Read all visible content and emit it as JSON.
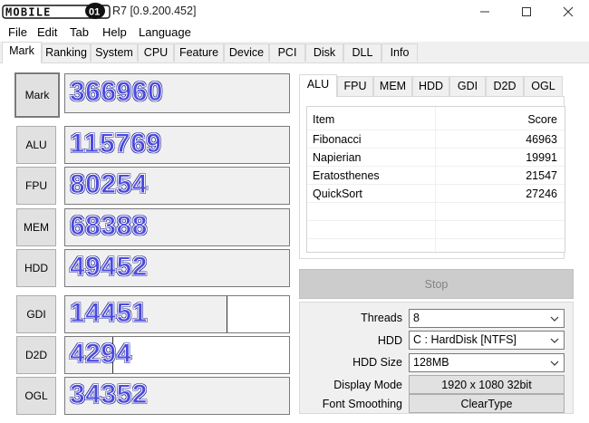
{
  "window": {
    "title": "R7 [0.9.200.452]",
    "logo_text": "MOBILE01"
  },
  "menu": [
    "File",
    "Edit",
    "Tab",
    "Help",
    "Language"
  ],
  "tabs": [
    "Mark",
    "Ranking",
    "System",
    "CPU",
    "Feature",
    "Device",
    "PCI",
    "Disk",
    "DLL",
    "Info"
  ],
  "marks": {
    "total": {
      "label": "Mark",
      "value": "366960",
      "fill": 1.0
    },
    "items": [
      {
        "label": "ALU",
        "value": "115769",
        "fill": 1.0
      },
      {
        "label": "FPU",
        "value": "80254",
        "fill": 1.0
      },
      {
        "label": "MEM",
        "value": "68388",
        "fill": 1.0
      },
      {
        "label": "HDD",
        "value": "49452",
        "fill": 1.0
      },
      {
        "label": "GDI",
        "value": "14451",
        "fill": 0.72
      },
      {
        "label": "D2D",
        "value": "4294",
        "fill": 0.21
      },
      {
        "label": "OGL",
        "value": "34352",
        "fill": 1.0
      }
    ]
  },
  "subtabs": [
    "ALU",
    "FPU",
    "MEM",
    "HDD",
    "GDI",
    "D2D",
    "OGL"
  ],
  "results": {
    "headers": {
      "item": "Item",
      "score": "Score"
    },
    "rows": [
      {
        "item": "Fibonacci",
        "score": "46963"
      },
      {
        "item": "Napierian",
        "score": "19991"
      },
      {
        "item": "Eratosthenes",
        "score": "21547"
      },
      {
        "item": "QuickSort",
        "score": "27246"
      }
    ]
  },
  "stop_label": "Stop",
  "settings": {
    "threads": {
      "label": "Threads",
      "value": "8"
    },
    "hdd": {
      "label": "HDD",
      "value": "C : HardDisk [NTFS]"
    },
    "hdd_size": {
      "label": "HDD Size",
      "value": "128MB"
    },
    "display_mode": {
      "label": "Display Mode",
      "value": "1920 x 1080 32bit"
    },
    "font_smoothing": {
      "label": "Font Smoothing",
      "value": "ClearType"
    }
  },
  "colors": {
    "score_text": "#4a4adf",
    "score_outline": "#2a2a9a"
  }
}
